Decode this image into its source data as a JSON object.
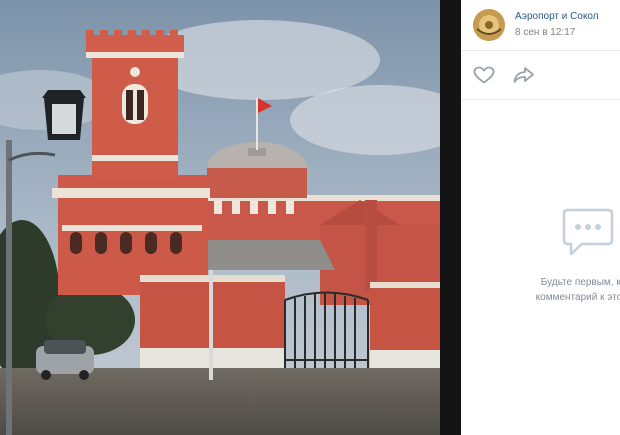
{
  "post": {
    "author": "Аэропорт и Сокол",
    "date": "8 сен в 12:17"
  },
  "actions": {
    "like_icon": "heart-outline-icon",
    "share_icon": "share-arrow-icon"
  },
  "comments": {
    "icon": "comment-bubble-icon",
    "empty_line1": "Будьте первым, кто о",
    "empty_line2": "комментарий к этой фо"
  },
  "colors": {
    "link": "#2a5885",
    "muted": "#828282",
    "divider": "#141414",
    "icon": "#99a2ad",
    "empty_text": "#818c99"
  }
}
